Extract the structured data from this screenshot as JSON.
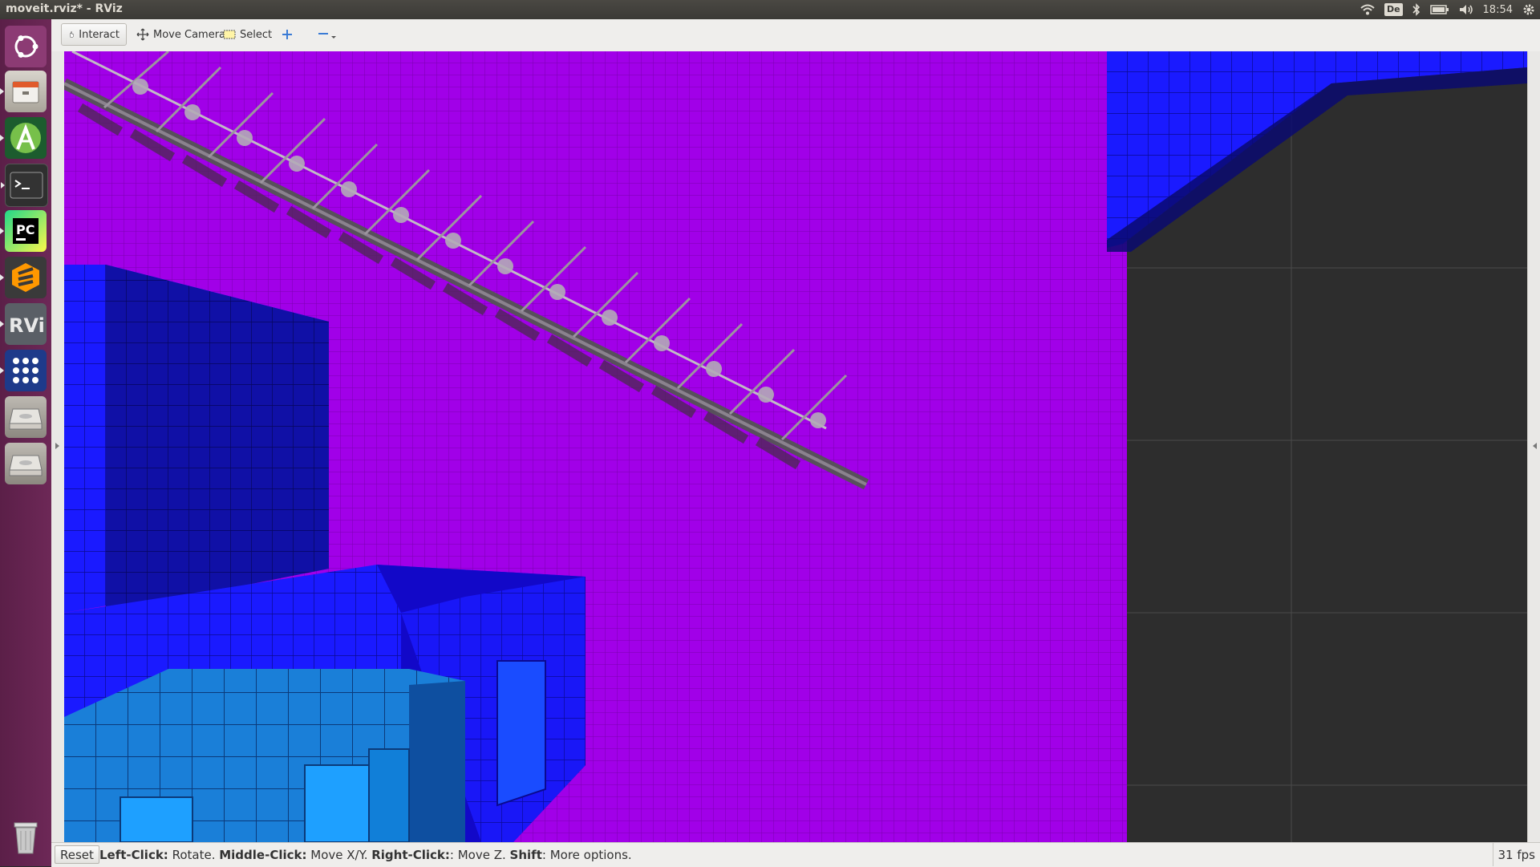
{
  "window": {
    "title": "moveit.rviz* - RViz"
  },
  "tray": {
    "keyboard": "De",
    "clock": "18:54"
  },
  "launcher": {
    "items": [
      {
        "name": "ubuntu-dash-icon"
      },
      {
        "name": "files-icon"
      },
      {
        "name": "android-studio-icon"
      },
      {
        "name": "terminal-icon"
      },
      {
        "name": "pycharm-icon"
      },
      {
        "name": "sublime-text-icon"
      },
      {
        "name": "rviz-icon",
        "label": "RViz"
      },
      {
        "name": "app-grid-icon"
      },
      {
        "name": "drive-icon"
      },
      {
        "name": "drive-icon-2"
      },
      {
        "name": "trash-icon"
      }
    ]
  },
  "toolbar": {
    "interact": "Interact",
    "move_camera": "Move Camera",
    "select": "Select"
  },
  "status": {
    "reset": "Reset",
    "hint": [
      {
        "bold": "Left-Click:",
        "text": " Rotate. "
      },
      {
        "bold": "Middle-Click:",
        "text": " Move X/Y. "
      },
      {
        "bold": "Right-Click:",
        "text": ": Move Z. "
      },
      {
        "bold": "Shift",
        "text": ": More options."
      }
    ],
    "fps": "31 fps"
  },
  "colors": {
    "magenta_wall": "#a100e8",
    "blue_voxel": "#1a1aff",
    "cyan_voxel": "#1a7fd8",
    "dark_grid": "#2d2d2d"
  }
}
